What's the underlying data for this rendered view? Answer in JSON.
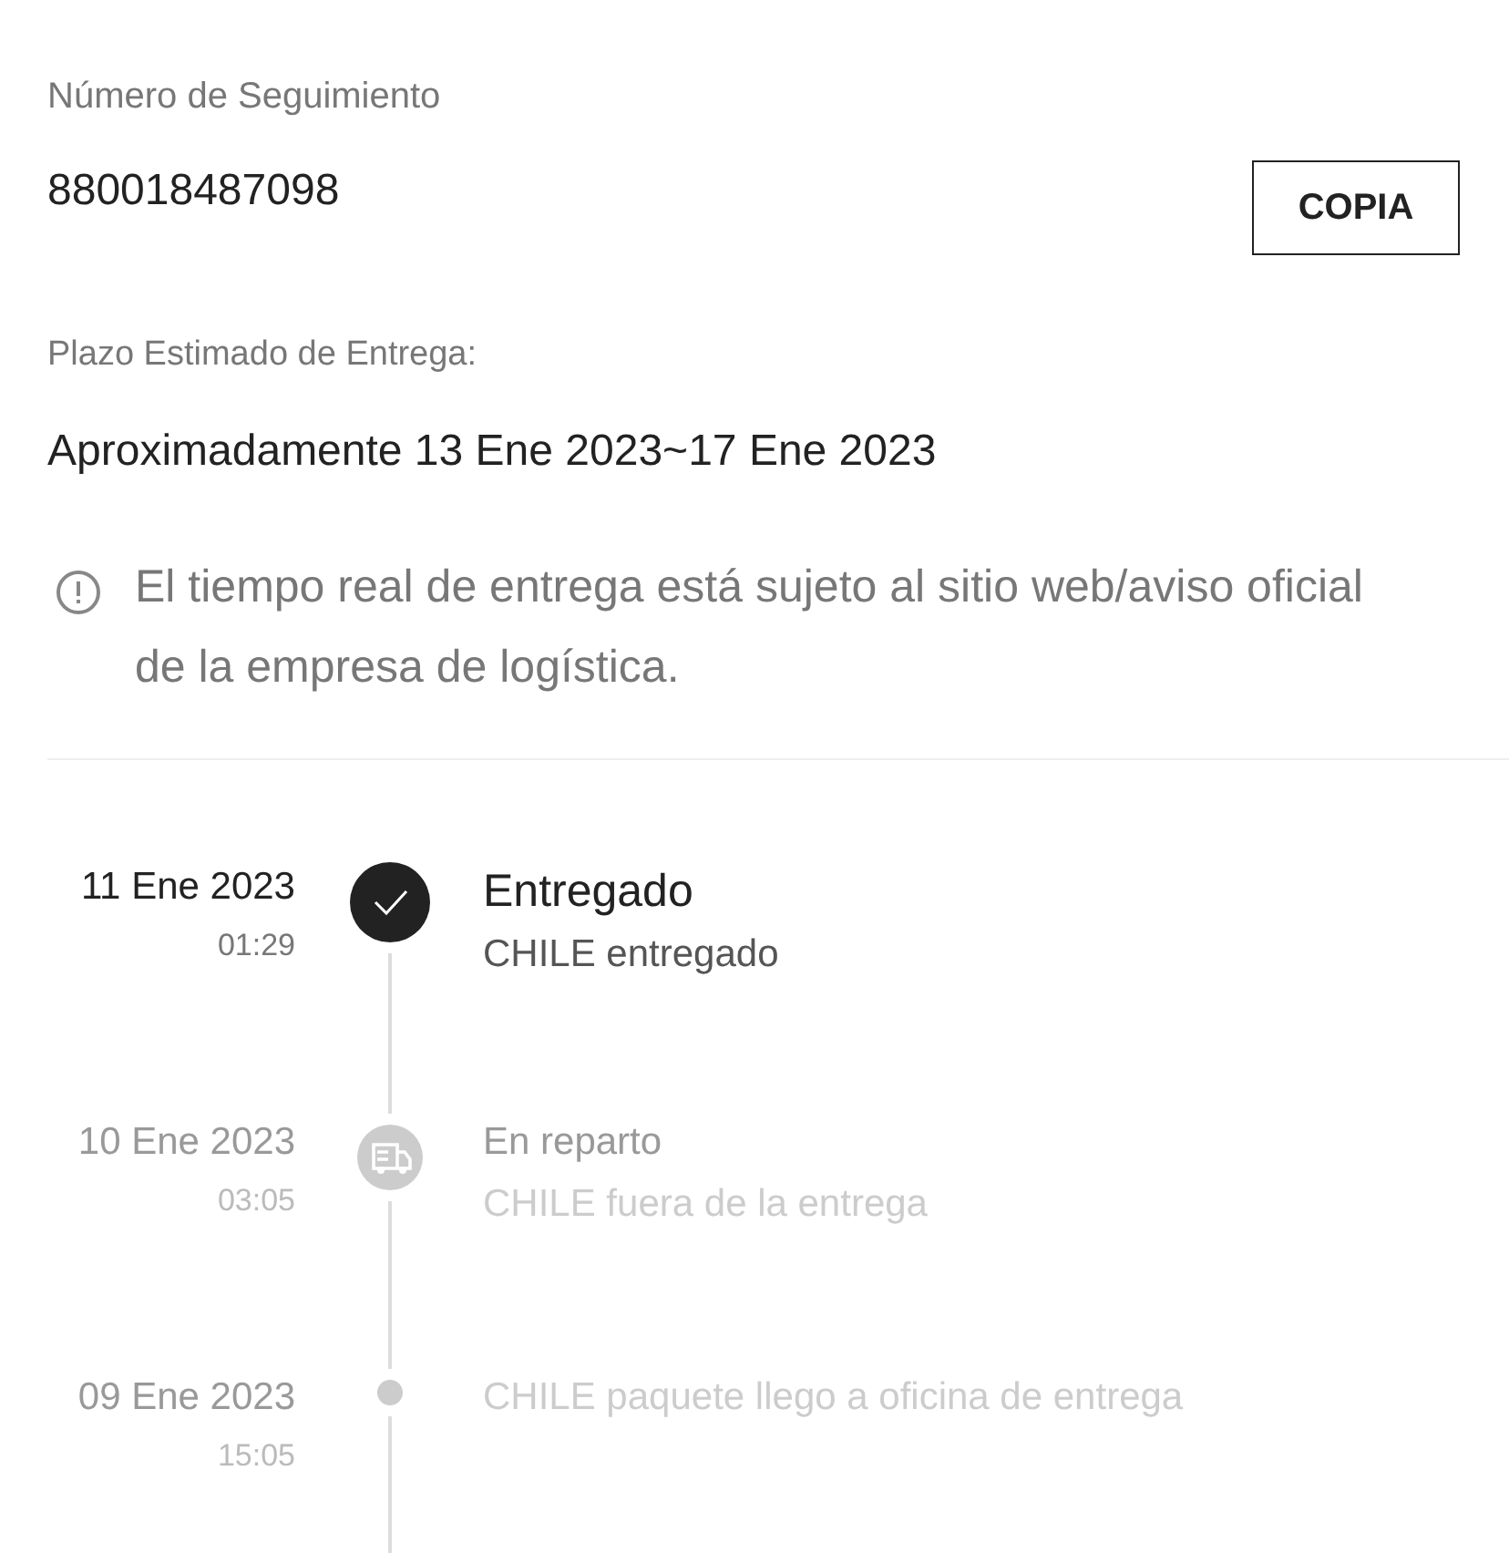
{
  "tracking": {
    "label": "Número de Seguimiento",
    "number": "880018487098",
    "copy_button": "COPIA"
  },
  "estimate": {
    "label": "Plazo Estimado de Entrega:",
    "value": "Aproximadamente 13 Ene 2023~17 Ene 2023"
  },
  "notice": "El tiempo real de entrega está sujeto al sitio web/aviso oficial de la empresa de logística.",
  "events": [
    {
      "kind": "delivered",
      "date": "11 Ene 2023",
      "time": "01:29",
      "title": "Entregado",
      "detail": "CHILE entregado",
      "current": true
    },
    {
      "kind": "truck",
      "date": "10 Ene 2023",
      "time": "03:05",
      "title": "En reparto",
      "detail": "CHILE fuera de la entrega",
      "current": false
    },
    {
      "kind": "dot",
      "date": "09 Ene 2023",
      "time": "15:05",
      "detail": "CHILE paquete llego a oficina de entrega",
      "current": false
    }
  ]
}
